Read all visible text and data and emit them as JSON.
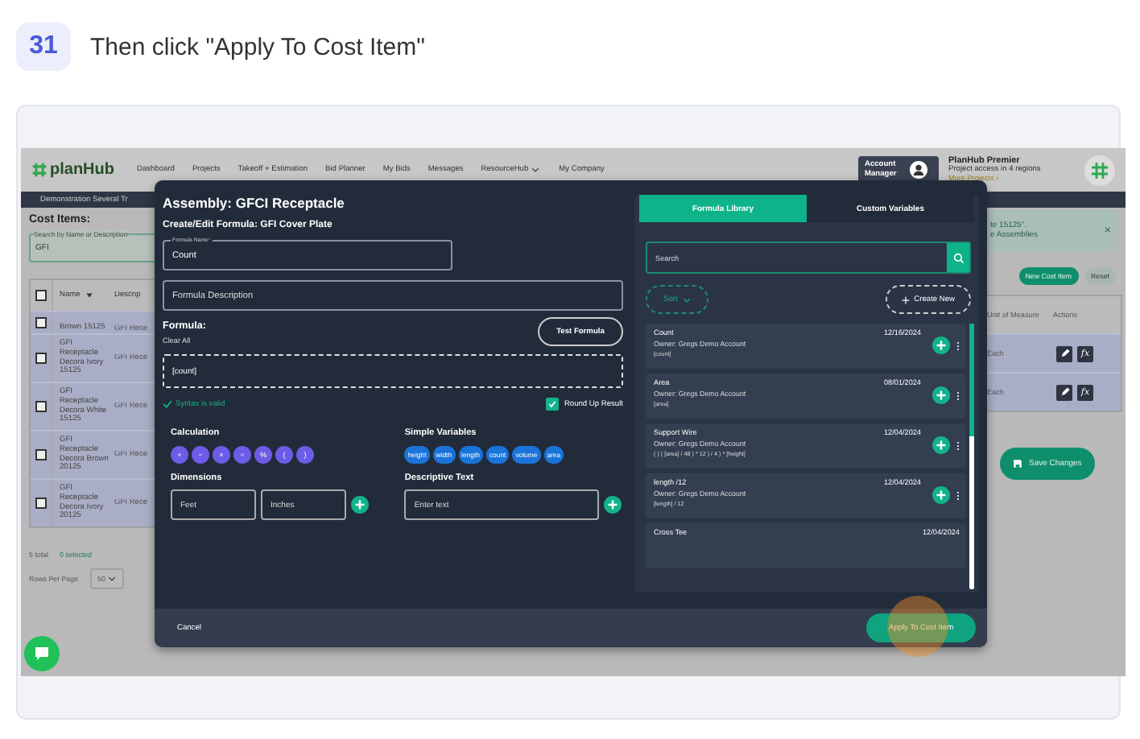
{
  "step": {
    "number": "31",
    "instruction": "Then click \"Apply To Cost Item\""
  },
  "nav": {
    "logo": "planHub",
    "links": [
      {
        "label": "Dashboard",
        "dropdown": false
      },
      {
        "label": "Projects",
        "dropdown": false
      },
      {
        "label": "Takeoff + Estimation",
        "dropdown": false
      },
      {
        "label": "Bid Planner",
        "dropdown": false
      },
      {
        "label": "My Bids",
        "dropdown": false
      },
      {
        "label": "Messages",
        "dropdown": false
      },
      {
        "label": "ResourceHub",
        "dropdown": true
      },
      {
        "label": "My Company",
        "dropdown": false
      }
    ],
    "account": "Account Manager",
    "plan": {
      "title": "PlanHub Premier",
      "detail": "Project access in 4 regions",
      "link": "More Projects ›"
    }
  },
  "project_bar": {
    "title": "Demonstration Several Tr"
  },
  "cost_items": {
    "title": "Cost Items:",
    "search": {
      "label": "Search by Name or Description",
      "value": "GFI"
    },
    "columns": [
      "Name",
      "Descrip"
    ],
    "all_checked": false,
    "rows": [
      {
        "name": "Brown 15125",
        "description": "GFI Rece",
        "checked": false
      },
      {
        "name": "GFI Receptacle Decora Ivory 15125",
        "description": "GFI Rece",
        "checked": false
      },
      {
        "name": "GFI Receptacle Decora White 15125",
        "description": "GFI Rece",
        "checked": false
      },
      {
        "name": "GFI Receptacle Decora Brown 20125",
        "description": "GFI Rece",
        "checked": false
      },
      {
        "name": "GFI Receptacle Decora Ivory 20125",
        "description": "GFI Rece",
        "checked": false
      }
    ],
    "total": "5 total",
    "selected_count": "0 selected",
    "rows_per_page_label": "Rows Per Page",
    "rows_per_page": "50"
  },
  "banner": {
    "lines": [
      "te 15125\".",
      "e Assemblies"
    ],
    "close": "×"
  },
  "toolbar": [
    "New Cost Item",
    "Reset"
  ],
  "unit_table": {
    "columns": [
      "Unit of Measure",
      "Actions"
    ],
    "rows": [
      {
        "unit": "Each",
        "formula_label": "fx"
      },
      {
        "unit": "Each",
        "formula_label": "fx"
      }
    ]
  },
  "save_button": "Save Changes",
  "modal": {
    "title": "Assembly: GFCI Receptacle",
    "subtitle": "Create/Edit Formula: GFI Cover Plate",
    "name_field": {
      "label": "Formula Name",
      "required_mark": "*",
      "value": "Count"
    },
    "description_field": {
      "placeholder": "Formula Description"
    },
    "formula_label": "Formula:",
    "clear_all": "Clear All",
    "test_button": "Test Formula",
    "formula": "[count]",
    "syntax_message": "Syntax is valid",
    "round_up": {
      "label": "Round Up Result",
      "checked": true
    },
    "calculation": {
      "title": "Calculation",
      "operators": [
        "+",
        "−",
        "×",
        "÷",
        "%",
        "(",
        ")"
      ]
    },
    "variables": {
      "title": "Simple Variables",
      "items": [
        "height",
        "width",
        "length",
        "count",
        "volume",
        "area"
      ]
    },
    "dimensions": {
      "title": "Dimensions",
      "fields": [
        {
          "placeholder": "Feet"
        },
        {
          "placeholder": "Inches"
        }
      ]
    },
    "descriptive_text": {
      "title": "Descriptive Text",
      "placeholder": "Enter text"
    },
    "library": {
      "tabs": [
        {
          "label": "Formula Library",
          "selected": true
        },
        {
          "label": "Custom Variables",
          "selected": false
        }
      ],
      "search_placeholder": "Search",
      "sort": "Sort",
      "create": "Create New",
      "items": [
        {
          "name": "Count",
          "date": "12/16/2024",
          "owner": "Owner: Gregs Demo Account",
          "expression": "[count]"
        },
        {
          "name": "Area",
          "date": "08/01/2024",
          "owner": "Owner: Gregs Demo Account",
          "expression": "[area]"
        },
        {
          "name": "Support Wire",
          "date": "12/04/2024",
          "owner": "Owner: Gregs Demo Account",
          "expression": "( ( ( [area] / 48 ) * 12 ) / 4 ) * [height]"
        },
        {
          "name": "length /12",
          "date": "12/04/2024",
          "owner": "Owner: Gregs Demo Account",
          "expression": "[length] / 12"
        },
        {
          "name": "Cross Tee",
          "date": "12/04/2024"
        }
      ]
    },
    "cancel": "Cancel",
    "apply": "Apply To Cost Item"
  }
}
